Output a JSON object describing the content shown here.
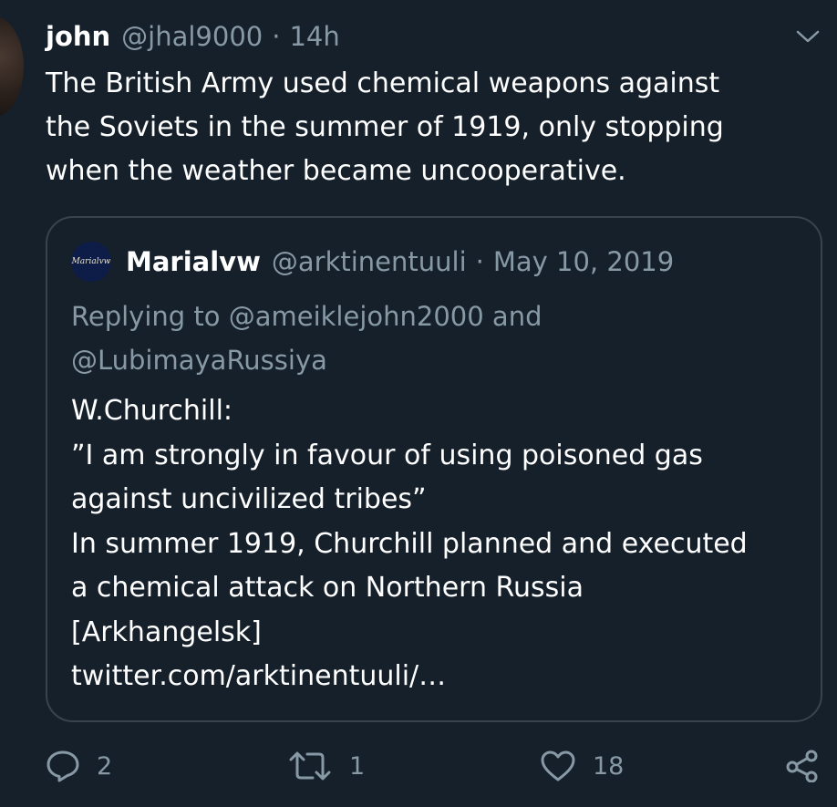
{
  "tweet": {
    "name": "john",
    "handle": "@jhal9000",
    "separator": "·",
    "time": "14h",
    "text": "The British Army used chemical weapons against\nthe Soviets in the summer of 1919, only stopping\nwhen the weather became uncooperative."
  },
  "quote": {
    "avatar_text": "Marialvw",
    "name": "Marialvw",
    "handle": "@arktinentuuli",
    "separator": "·",
    "date": "May 10, 2019",
    "replying_prefix": "Replying to ",
    "replying_user1": "@ameiklejohn2000",
    "replying_and": " and",
    "replying_user2": "@LubimayaRussiya",
    "body": "W.Churchill:\n”I am strongly in favour of using poisoned gas\nagainst uncivilized tribes”\n In summer 1919, Churchill planned and executed\na chemical attack on Northern Russia\n[Arkhangelsk]\n twitter.com/arktinentuuli/…"
  },
  "actions": {
    "reply_count": "2",
    "retweet_count": "1",
    "like_count": "18"
  },
  "colors": {
    "background": "#15202b",
    "secondary_text": "#8899a6",
    "border": "#38444d"
  },
  "icons": [
    "chevron-down-icon",
    "reply-icon",
    "retweet-icon",
    "like-icon",
    "share-icon"
  ]
}
